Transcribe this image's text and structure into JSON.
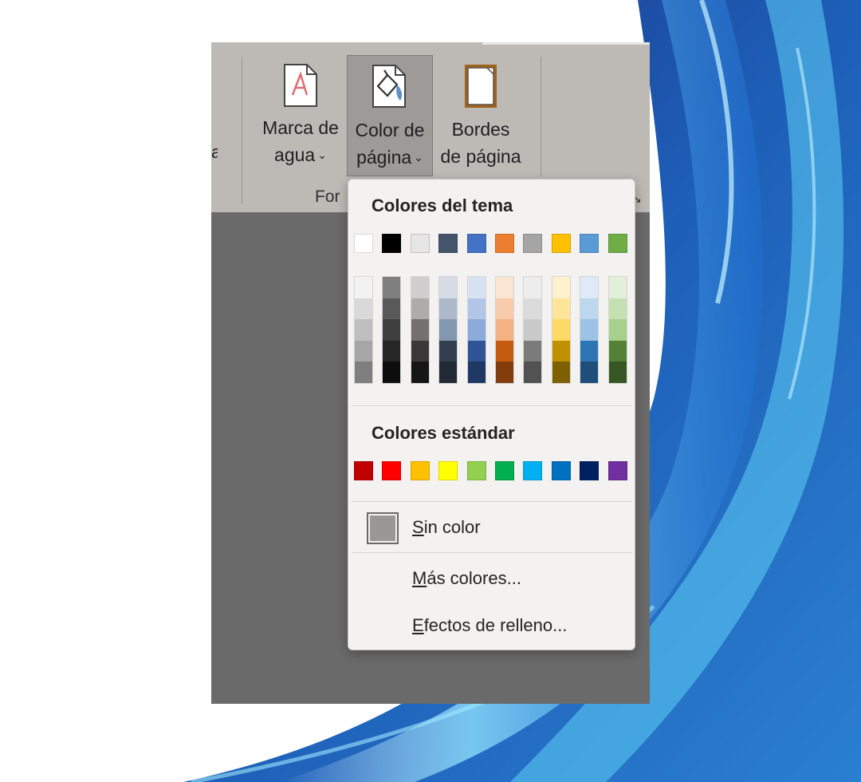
{
  "ribbon": {
    "partial_left_label": "a",
    "watermark": {
      "line1": "Marca de",
      "line2": "agua",
      "icon": "watermark-icon"
    },
    "page_color": {
      "line1": "Color de",
      "line2": "página",
      "icon": "page-color-icon"
    },
    "page_borders": {
      "line1": "Bordes",
      "line2": "de página",
      "icon": "page-borders-icon"
    },
    "group_label": "For",
    "chevron": "⌄",
    "launcher": "↘"
  },
  "color_menu": {
    "theme_heading": "Colores del tema",
    "theme_colors": [
      "#ffffff",
      "#000000",
      "#e7e6e6",
      "#44546a",
      "#4472c4",
      "#ed7d31",
      "#a5a5a5",
      "#ffc000",
      "#5b9bd5",
      "#70ad47"
    ],
    "theme_shades": [
      [
        "#f2f2f2",
        "#d9d9d9",
        "#bfbfbf",
        "#a6a6a6",
        "#7f7f7f"
      ],
      [
        "#7f7f7f",
        "#595959",
        "#404040",
        "#262626",
        "#0d0d0d"
      ],
      [
        "#d0cece",
        "#aeabab",
        "#757070",
        "#3a3838",
        "#171616"
      ],
      [
        "#d6dce4",
        "#adb9ca",
        "#8497b0",
        "#323f4f",
        "#222a35"
      ],
      [
        "#d9e2f3",
        "#b4c6e7",
        "#8eaadb",
        "#2f5496",
        "#1f3864"
      ],
      [
        "#fbe5d5",
        "#f7cbac",
        "#f4b183",
        "#c55a11",
        "#833c0b"
      ],
      [
        "#ededed",
        "#dbdbdb",
        "#c9c9c9",
        "#7b7b7b",
        "#525252"
      ],
      [
        "#fff2cc",
        "#fee599",
        "#ffd965",
        "#bf9000",
        "#7f6000"
      ],
      [
        "#deeaf6",
        "#bdd7ee",
        "#9cc3e5",
        "#2e75b5",
        "#1e4e79"
      ],
      [
        "#e2efd9",
        "#c5e0b3",
        "#a8d08d",
        "#538135",
        "#375623"
      ]
    ],
    "standard_heading": "Colores estándar",
    "standard_colors": [
      "#c00000",
      "#ff0000",
      "#ffc000",
      "#ffff00",
      "#92d050",
      "#00b050",
      "#00b0f0",
      "#0070c0",
      "#002060",
      "#7030a0"
    ],
    "no_color": {
      "key": "S",
      "rest": "in color",
      "icon": "no-color-swatch-icon"
    },
    "more_colors": {
      "key": "M",
      "rest": "ás colores..."
    },
    "fill_effects": {
      "key": "E",
      "rest": "fectos de relleno..."
    }
  }
}
